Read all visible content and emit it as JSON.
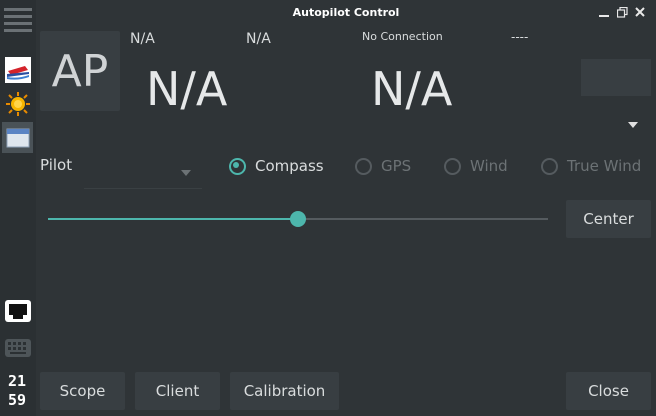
{
  "window": {
    "title": "Autopilot Control"
  },
  "sidebar": {
    "clock_hours": "21",
    "clock_minutes": "59",
    "icons": [
      "menu-icon",
      "boat-icon",
      "sun-icon",
      "window-icon",
      "network-icon",
      "keyboard-icon"
    ]
  },
  "ap_button": "AP",
  "top": {
    "heading_label": "N/A",
    "command_label": "N/A",
    "connection_status": "No Connection",
    "dashes": "----",
    "heading_value": "N/A",
    "command_value": "N/A"
  },
  "pilot": {
    "label": "Pilot",
    "selected": ""
  },
  "modes": [
    {
      "label": "Compass",
      "checked": true,
      "enabled": true
    },
    {
      "label": "GPS",
      "checked": false,
      "enabled": false
    },
    {
      "label": "Wind",
      "checked": false,
      "enabled": false
    },
    {
      "label": "True Wind",
      "checked": false,
      "enabled": false
    }
  ],
  "slider": {
    "value_fraction": 0.5
  },
  "buttons": {
    "center": "Center",
    "scope": "Scope",
    "client": "Client",
    "calibration": "Calibration",
    "close": "Close"
  },
  "colors": {
    "accent": "#4db6ac",
    "background": "#2f3437",
    "button": "#383e42"
  }
}
